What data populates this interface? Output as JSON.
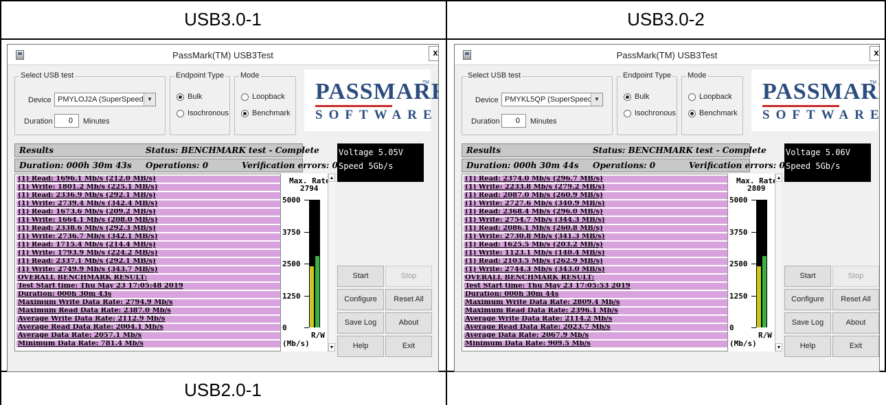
{
  "columns": [
    {
      "title": "USB3.0-1"
    },
    {
      "title": "USB3.0-2"
    }
  ],
  "bottom_row": {
    "title": "USB2.0-1"
  },
  "windows": [
    {
      "title": "PassMark(TM) USB3Test",
      "close_label": "x",
      "select_group": "Select USB test",
      "device_label": "Device",
      "device_value": "PMYLOJ2A (SuperSpeed)",
      "duration_label": "Duration",
      "duration_value": "0",
      "minutes_label": "Minutes",
      "endpoint_group": "Endpoint Type",
      "bulk_label": "Bulk",
      "iso_label": "Isochronous",
      "mode_group": "Mode",
      "loopback_label": "Loopback",
      "benchmark_label": "Benchmark",
      "endpoint_selected": "Bulk",
      "mode_selected": "Benchmark",
      "logo_line1": "PASSMARK",
      "logo_tm": "TM",
      "logo_line2": "SOFTWARE",
      "results_label": "Results",
      "status_text": "Status: BENCHMARK test - Complete",
      "duration_text": "Duration: 000h 30m 43s",
      "operations_text": "Operations: 0",
      "verification_text": "Verification errors: 0",
      "voltage_text": "Voltage  5.05V",
      "speed_text": "Speed  5Gb/s",
      "log_lines": [
        "(1) Read: 1696.1 Mb/s (212.0 MB/s)",
        "(1) Write: 1801.2 Mb/s (225.1 MB/s)",
        "(1) Read: 2336.9 Mb/s (292.1 MB/s)",
        "(1) Write: 2739.4 Mb/s (342.4 MB/s)",
        "(1) Read: 1673.6 Mb/s (209.2 MB/s)",
        "(1) Write: 1664.1 Mb/s (208.0 MB/s)",
        "(1) Read: 2338.6 Mb/s (292.3 MB/s)",
        "(1) Write: 2736.7 Mb/s (342.1 MB/s)",
        "(1) Read: 1715.4 Mb/s (214.4 MB/s)",
        "(1) Write: 1793.9 Mb/s (224.2 MB/s)",
        "(1) Read: 2337.1 Mb/s (292.1 MB/s)",
        "(1) Write: 2749.9 Mb/s (343.7 MB/s)",
        "OVERALL BENCHMARK RESULT:",
        "Test Start time: Thu May 23 17:05:48 2019",
        "Duration: 000h 30m 43s",
        "Maximum Write Data Rate: 2794.9 Mb/s",
        "Maximum Read Data Rate: 2387.0 Mb/s",
        "Average Write Data Rate: 2112.9 Mb/s",
        "Average Read Data Rate: 2004.1 Mb/s",
        "Average Data Rate: 2057.1 Mb/s",
        "Minimum Data Rate: 781.4 Mb/s"
      ],
      "gauge": {
        "max_rate_label": "Max. Rate",
        "max_rate_value": "2794",
        "scale_labels": [
          "5000",
          "3750",
          "2500",
          "1250",
          "0"
        ],
        "scale_max": 5000,
        "read_value": 2387.0,
        "write_value": 2794.9,
        "rw_label": "R/W",
        "unit_label": "(Mb/s)",
        "read_color": "#c8c81e",
        "write_color": "#3cb043"
      },
      "buttons": {
        "start": "Start",
        "stop": "Stop",
        "configure": "Configure",
        "reset_all": "Reset All",
        "save_log": "Save Log",
        "about": "About",
        "help": "Help",
        "exit": "Exit"
      }
    },
    {
      "title": "PassMark(TM) USB3Test",
      "close_label": "x",
      "select_group": "Select USB test",
      "device_label": "Device",
      "device_value": "PMYKL5QP (SuperSpeed)",
      "duration_label": "Duration",
      "duration_value": "0",
      "minutes_label": "Minutes",
      "endpoint_group": "Endpoint Type",
      "bulk_label": "Bulk",
      "iso_label": "Isochronous",
      "mode_group": "Mode",
      "loopback_label": "Loopback",
      "benchmark_label": "Benchmark",
      "endpoint_selected": "Bulk",
      "mode_selected": "Benchmark",
      "logo_line1": "PASSMARK",
      "logo_tm": "TM",
      "logo_line2": "SOFTWARE",
      "results_label": "Results",
      "status_text": "Status: BENCHMARK test - Complete",
      "duration_text": "Duration: 000h 30m 44s",
      "operations_text": "Operations: 0",
      "verification_text": "Verification errors: 0",
      "voltage_text": "Voltage  5.06V",
      "speed_text": "Speed  5Gb/s",
      "log_lines": [
        "(1) Read: 2374.0 Mb/s (296.7 MB/s)",
        "(1) Write: 2233.8 Mb/s (279.2 MB/s)",
        "(1) Read: 2087.0 Mb/s (260.9 MB/s)",
        "(1) Write: 2727.6 Mb/s (340.9 MB/s)",
        "(1) Read: 2368.4 Mb/s (296.0 MB/s)",
        "(1) Write: 2754.7 Mb/s (344.3 MB/s)",
        "(1) Read: 2086.1 Mb/s (260.8 MB/s)",
        "(1) Write: 2730.8 Mb/s (341.3 MB/s)",
        "(1) Read: 1625.5 Mb/s (203.2 MB/s)",
        "(1) Write: 1123.1 Mb/s (140.4 MB/s)",
        "(1) Read: 2103.5 Mb/s (262.9 MB/s)",
        "(1) Write: 2744.3 Mb/s (343.0 MB/s)",
        "OVERALL BENCHMARK RESULT:",
        "Test Start time: Thu May 23 17:05:53 2019",
        "Duration: 000h 30m 44s",
        "Maximum Write Data Rate: 2809.4 Mb/s",
        "Maximum Read Data Rate: 2396.1 Mb/s",
        "Average Write Data Rate: 2114.2 Mb/s",
        "Average Read Data Rate: 2023.7 Mb/s",
        "Average Data Rate: 2067.9 Mb/s",
        "Minimum Data Rate: 909.5 Mb/s"
      ],
      "gauge": {
        "max_rate_label": "Max. Rate",
        "max_rate_value": "2809",
        "scale_labels": [
          "5000",
          "3750",
          "2500",
          "1250",
          "0"
        ],
        "scale_max": 5000,
        "read_value": 2396.1,
        "write_value": 2809.4,
        "rw_label": "R/W",
        "unit_label": "(Mb/s)",
        "read_color": "#c8c81e",
        "write_color": "#3cb043"
      },
      "buttons": {
        "start": "Start",
        "stop": "Stop",
        "configure": "Configure",
        "reset_all": "Reset All",
        "save_log": "Save Log",
        "about": "About",
        "help": "Help",
        "exit": "Exit"
      }
    }
  ]
}
